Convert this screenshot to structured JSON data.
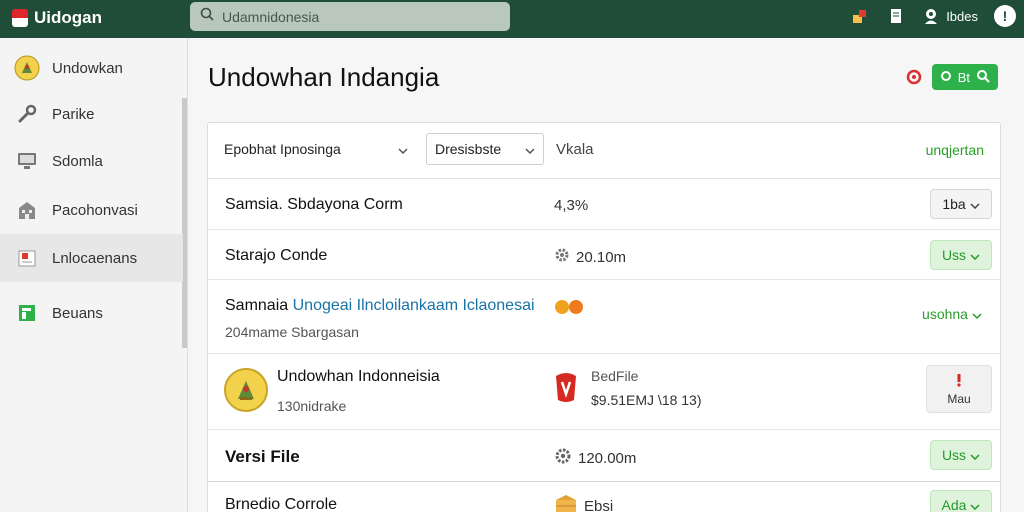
{
  "header": {
    "brand": "Uidogan",
    "search_placeholder": "Udamnidonesia",
    "user_label": "Ibdes",
    "help_label": "!"
  },
  "sidebar": {
    "items": [
      {
        "label": "Undowkan",
        "icon": "emblem-icon"
      },
      {
        "label": "Parike",
        "icon": "wrench-icon"
      },
      {
        "label": "Sdomla",
        "icon": "monitor-icon"
      },
      {
        "label": "Pacohonvasi",
        "icon": "building-icon"
      },
      {
        "label": "Lnlocaenans",
        "icon": "flag-document-icon"
      },
      {
        "label": "Beuans",
        "icon": "green-flag-icon"
      }
    ]
  },
  "main": {
    "title": "Undowhan Indangia",
    "go_label": "Bt",
    "filters": {
      "select1": "Epobhat Ipnosinga",
      "select2": "Dresisbste",
      "text": "Vkala",
      "link": "unqjertan"
    },
    "rows": [
      {
        "name": "Samsia. Sbdayona Corm",
        "meta": "4,3%",
        "action": "1ba"
      },
      {
        "name": "Starajo Conde",
        "meta": "20.10m",
        "action": "Uss"
      },
      {
        "name_prefix": "Samnaia",
        "name_link": "Unogeai Ilncloilankaam Iclaonesai",
        "sub": "204mame Sbargasan",
        "action": "usohna"
      },
      {
        "name": "Undowhan Indonneisia",
        "sub": "130nidrake",
        "meta_top": "BedFile",
        "meta_bottom": "$9.51EMJ \\18 13)",
        "action": "Mau"
      },
      {
        "name": "Versi File",
        "meta": "120.00m",
        "action": "Uss"
      },
      {
        "name": "Brnedio Corrole",
        "meta": "Ebsi",
        "action": "Ada"
      }
    ]
  },
  "colors": {
    "topbar": "#1f4d38",
    "accent_green": "#2eb14b",
    "link_green": "#2a9d2a",
    "link_blue": "#1a73a8"
  }
}
